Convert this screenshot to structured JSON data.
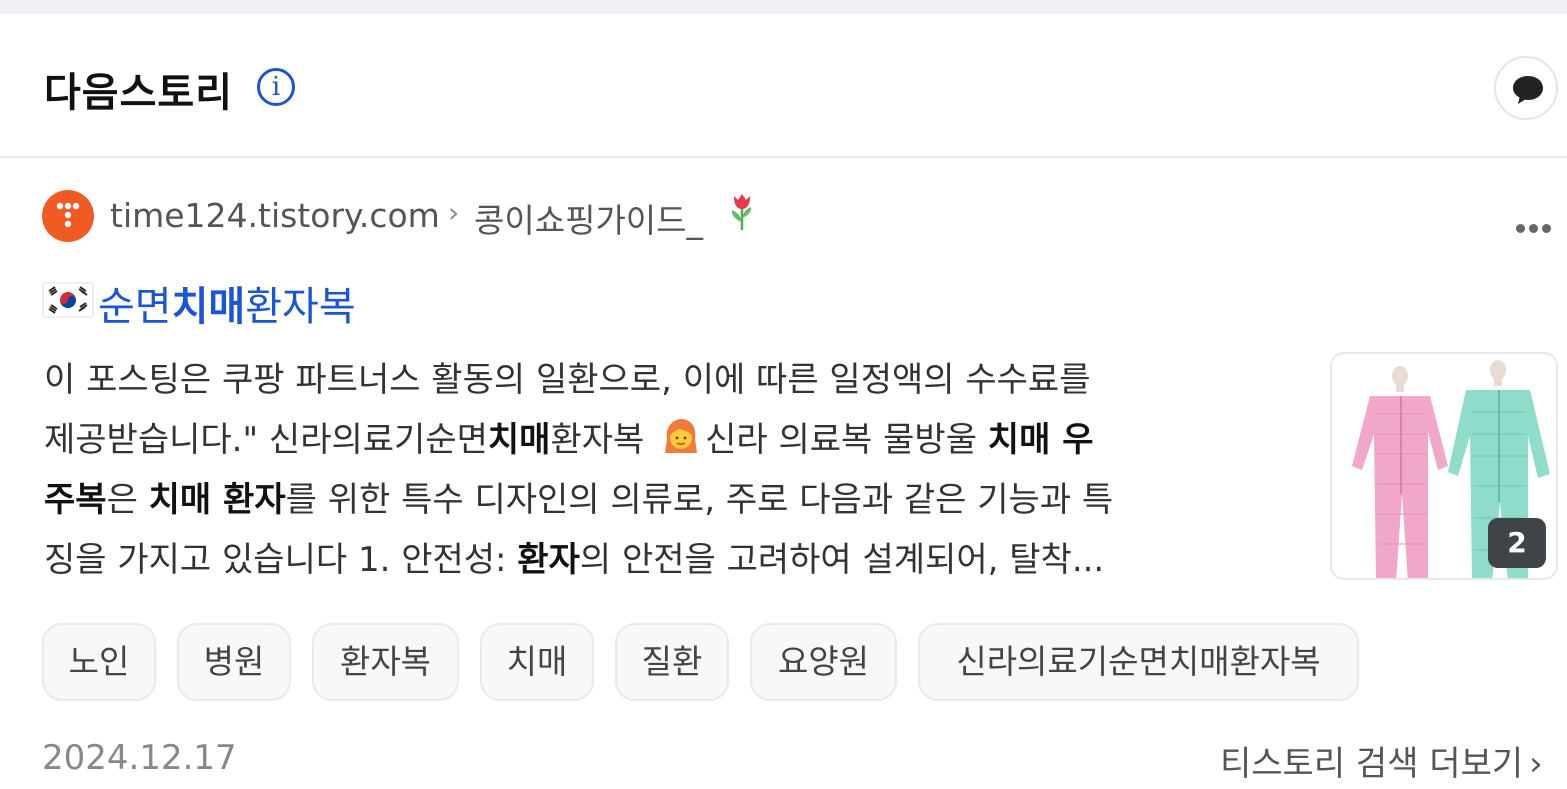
{
  "header": {
    "title": "다음스토리",
    "info_icon": "info-icon",
    "comment_icon": "comment-icon"
  },
  "result": {
    "site_url": "time124.tistory.com",
    "breadcrumb_sep": "›",
    "site_name": "콩이쇼핑가이드_",
    "title_parts": [
      "순면",
      "치매",
      "환자복"
    ],
    "snippet_lines": [
      [
        {
          "t": "이 포스팅은 쿠팡 파트너스 활동의 일환으로, 이에 따른 일정액의 수수료를",
          "b": false
        }
      ],
      [
        {
          "t": "제공받습니다.\" 신라의료기순면",
          "b": false
        },
        {
          "t": "치매",
          "b": true
        },
        {
          "t": "환자복 ",
          "b": false
        },
        {
          "emoji": "woman-face"
        },
        {
          "t": "신라 의료복 물방울 ",
          "b": false
        },
        {
          "t": "치매 우",
          "b": true
        }
      ],
      [
        {
          "t": "주복",
          "b": true
        },
        {
          "t": "은 ",
          "b": false
        },
        {
          "t": "치매 환자",
          "b": true
        },
        {
          "t": "를 위한 특수 디자인의 의류로, 주로 다음과 같은 기능과 특",
          "b": false
        }
      ],
      [
        {
          "t": "징을 가지고 있습니다 1. 안전성: ",
          "b": false
        },
        {
          "t": "환자",
          "b": true
        },
        {
          "t": "의 안전을 고려하여 설계되어, 탈착...",
          "b": false
        }
      ]
    ],
    "thumbnail_count": "2",
    "tags": [
      "노인",
      "병원",
      "환자복",
      "치매",
      "질환",
      "요양원",
      "신라의료기순면치매환자복"
    ],
    "date": "2024.12.17",
    "more_link": "티스토리 검색 더보기",
    "more_chevron": "›"
  },
  "colors": {
    "link_blue": "#1a55d6",
    "tistory_orange": "#f15a22",
    "tag_bg": "#f7f8fa",
    "badge_bg": "#3e4447"
  }
}
